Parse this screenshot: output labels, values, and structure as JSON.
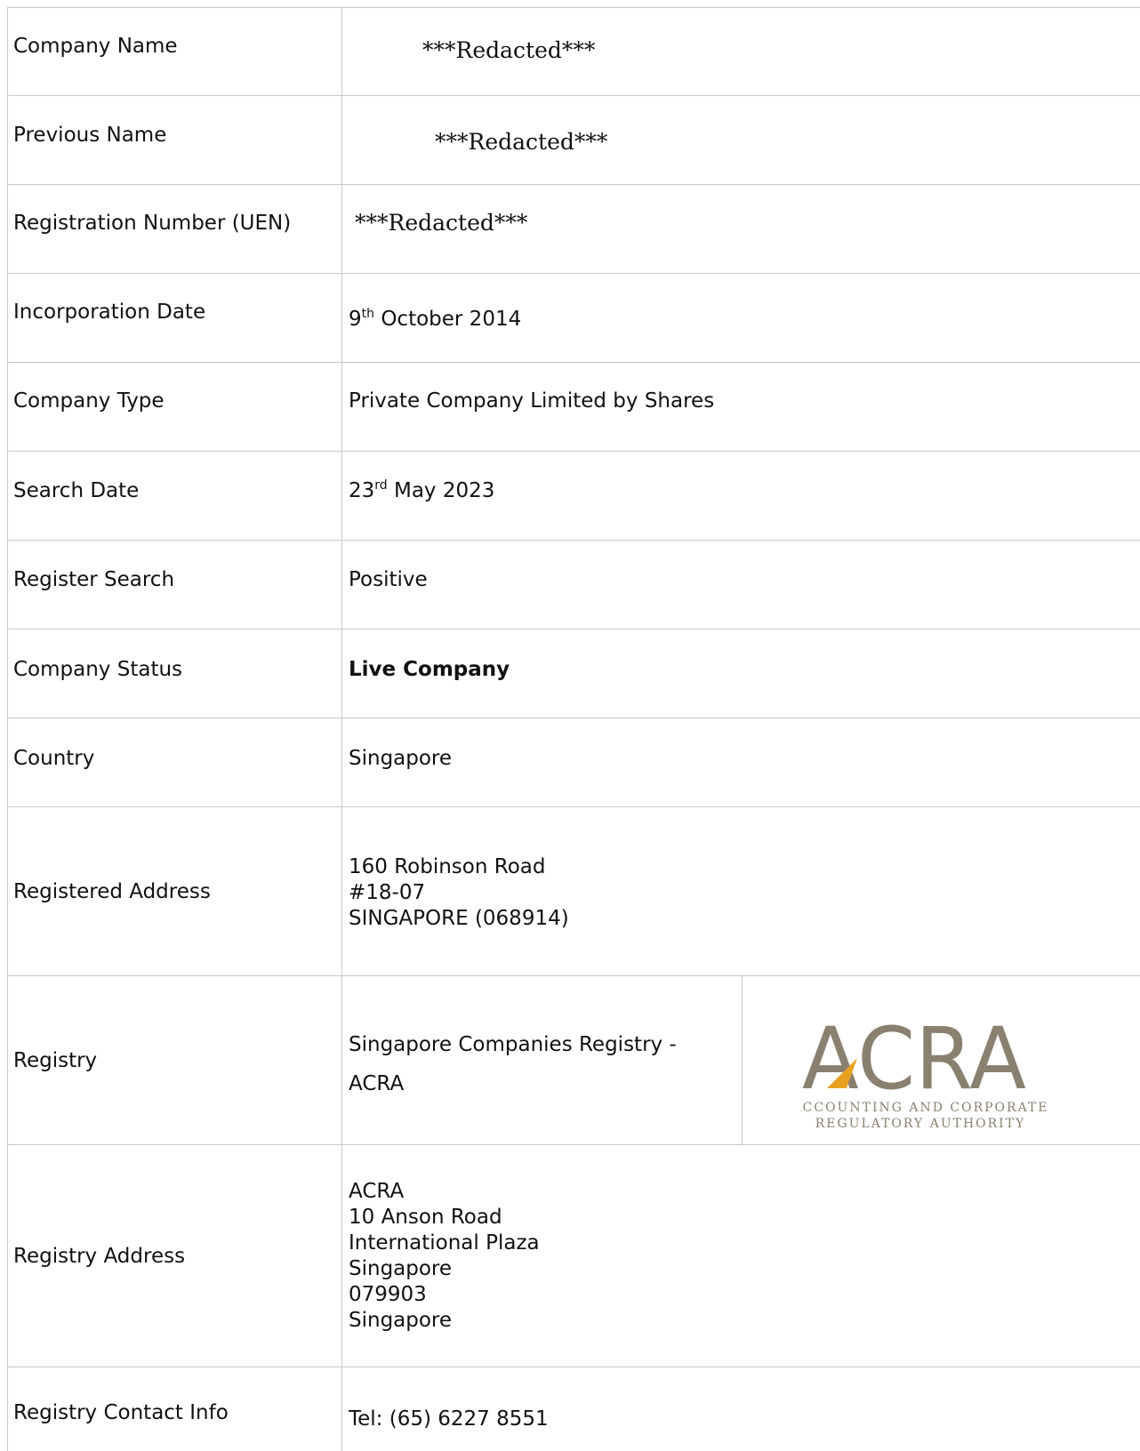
{
  "rows": [
    {
      "label": "Company Name",
      "value": "***Redacted***"
    },
    {
      "label": "Previous Name",
      "value": "***Redacted***"
    },
    {
      "label": "Registration Number (UEN)",
      "value": "***Redacted***"
    },
    {
      "label": "Incorporation Date",
      "value_day": "9",
      "value_sup": "th",
      "value_rest": " October 2014"
    },
    {
      "label": "Company Type",
      "value": "Private Company Limited by Shares"
    },
    {
      "label": "Search Date",
      "value_day": "23",
      "value_sup": "rd",
      "value_rest": " May 2023"
    },
    {
      "label": "Register Search",
      "value": "Positive"
    },
    {
      "label": "Company Status",
      "value": "Live Company"
    },
    {
      "label": "Country",
      "value": "Singapore"
    },
    {
      "label": "Registered Address",
      "lines": [
        "160 Robinson Road",
        "#18-07",
        "SINGAPORE (068914)"
      ]
    },
    {
      "label": "Registry",
      "lines": [
        "Singapore Companies Registry -",
        "ACRA"
      ]
    },
    {
      "label": "Registry Address",
      "lines": [
        "ACRA",
        "10 Anson Road",
        "International Plaza",
        "Singapore",
        "079903",
        "Singapore"
      ]
    },
    {
      "label": "Registry Contact Info",
      "value": "Tel: (65) 6227 8551"
    }
  ],
  "logo": {
    "text": "ACRA",
    "subtitle_line1": "ACCOUNTING AND CORPORATE",
    "subtitle_line2": "REGULATORY AUTHORITY",
    "color": "#8a8070",
    "accent": "#e8a020"
  }
}
